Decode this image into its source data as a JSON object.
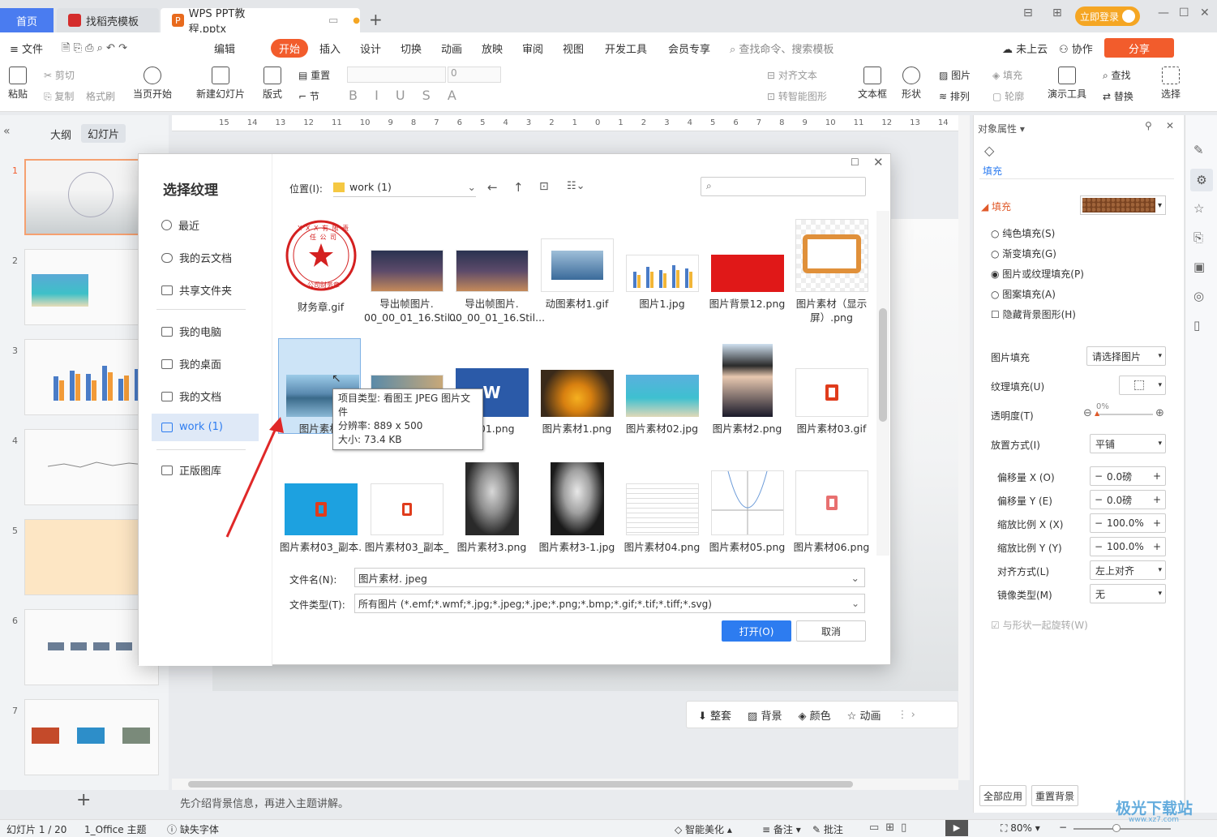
{
  "tabs": {
    "home": "首页",
    "template": "找稻壳模板",
    "doc": "WPS PPT教程.pptx"
  },
  "login": "立即登录",
  "menu": {
    "file": "文件",
    "items": [
      "编辑",
      "开始",
      "插入",
      "设计",
      "切换",
      "动画",
      "放映",
      "审阅",
      "视图",
      "开发工具",
      "会员专享"
    ],
    "search": "查找命令、搜索模板",
    "cloud": "未上云",
    "collab": "协作",
    "share": "分享"
  },
  "ribbon": {
    "paste": "粘贴",
    "cut": "剪切",
    "copy": "复制",
    "format": "格式刷",
    "from_current": "当页开始",
    "new_slide": "新建幻灯片",
    "layout": "版式",
    "reset": "重置",
    "section": "节",
    "font_size": "0",
    "align_text": "对齐文本",
    "smart_shape": "转智能图形",
    "textbox": "文本框",
    "shapes": "形状",
    "picture": "图片",
    "fill": "填充",
    "arrange": "排列",
    "outline": "轮廓",
    "present_tools": "演示工具",
    "find": "查找",
    "replace": "替换",
    "select": "选择"
  },
  "left_panel": {
    "outline": "大纲",
    "slides": "幻灯片",
    "numbers": [
      "1",
      "2",
      "3",
      "4",
      "5",
      "6",
      "7"
    ]
  },
  "ruler": [
    "15",
    "14",
    "13",
    "12",
    "11",
    "10",
    "9",
    "8",
    "7",
    "6",
    "5",
    "4",
    "3",
    "2",
    "1",
    "0",
    "1",
    "2",
    "3",
    "4",
    "5",
    "6",
    "7",
    "8",
    "9",
    "10",
    "11",
    "12",
    "13",
    "14"
  ],
  "dialog": {
    "title": "选择纹理",
    "location_label": "位置(I):",
    "location": "work (1)",
    "sidebar": [
      "最近",
      "我的云文档",
      "共享文件夹",
      "我的电脑",
      "我的桌面",
      "我的文档",
      "work (1)",
      "正版图库"
    ],
    "files": [
      {
        "name": "财务章.gif"
      },
      {
        "name": "导出帧图片.\n00_00_01_16.Stil..."
      },
      {
        "name": "导出帧图片.\n00_00_01_16.Stil..."
      },
      {
        "name": "动图素材1.gif"
      },
      {
        "name": "图片1.jpg"
      },
      {
        "name": "图片背景12.png"
      },
      {
        "name": "图片素材（显示\n屏）.png"
      },
      {
        "name": "图片素材.j"
      },
      {
        "name": ""
      },
      {
        "name": "材01.png"
      },
      {
        "name": "图片素材1.png"
      },
      {
        "name": "图片素材02.jpg"
      },
      {
        "name": "图片素材2.png"
      },
      {
        "name": "图片素材03.gif"
      },
      {
        "name": "图片素材03_副本."
      },
      {
        "name": "图片素材03_副本_"
      },
      {
        "name": "图片素材3.png"
      },
      {
        "name": "图片素材3-1.jpg"
      },
      {
        "name": "图片素材04.png"
      },
      {
        "name": "图片素材05.png"
      },
      {
        "name": "图片素材06.png"
      }
    ],
    "stamp_text": "X X X 有 限 责 任 公 司",
    "stamp_sub": "公司财务章",
    "tooltip": [
      "项目类型: 看图王 JPEG 图片文件",
      "分辨率: 889 x 500",
      "大小: 73.4 KB"
    ],
    "filename_label": "文件名(N):",
    "filename": "图片素材. jpeg",
    "filetype_label": "文件类型(T):",
    "filetype": "所有图片 (*.emf;*.wmf;*.jpg;*.jpeg;*.jpe;*.png;*.bmp;*.gif;*.tif;*.tiff;*.svg)",
    "open": "打开(O)",
    "cancel": "取消"
  },
  "bottom_tools": [
    "整套",
    "背景",
    "颜色",
    "动画"
  ],
  "notes": "先介绍背景信息，再进入主题讲解。",
  "right_panel": {
    "title": "对象属性",
    "tab": "填充",
    "section": "填充",
    "options": [
      "纯色填充(S)",
      "渐变填充(G)",
      "图片或纹理填充(P)",
      "图案填充(A)"
    ],
    "hide_bg": "隐藏背景图形(H)",
    "picture_fill_label": "图片填充",
    "picture_fill": "请选择图片",
    "texture_fill_label": "纹理填充(U)",
    "transparency_label": "透明度(T)",
    "transparency": "0%",
    "placement_label": "放置方式(I)",
    "placement": "平铺",
    "offset_x_label": "偏移量 X (O)",
    "offset_x": "0.0磅",
    "offset_y_label": "偏移量 Y (E)",
    "offset_y": "0.0磅",
    "scale_x_label": "缩放比例 X (X)",
    "scale_x": "100.0%",
    "scale_y_label": "缩放比例 Y (Y)",
    "scale_y": "100.0%",
    "align_label": "对齐方式(L)",
    "align": "左上对齐",
    "mirror_label": "镜像类型(M)",
    "mirror": "无",
    "rotate": "与形状一起旋转(W)",
    "apply_all": "全部应用",
    "reset_bg": "重置背景"
  },
  "status": {
    "slide": "幻灯片 1 / 20",
    "theme": "1_Office 主题",
    "missing_font": "缺失字体",
    "beautify": "智能美化",
    "notes": "备注",
    "comment": "批注",
    "zoom": "80%"
  },
  "watermark": "极光下载站",
  "watermark_url": "www.xz7.com",
  "colors": {
    "accent": "#f25c2c",
    "primary": "#2d7cf0",
    "tab_active": "#4a7cf0"
  }
}
